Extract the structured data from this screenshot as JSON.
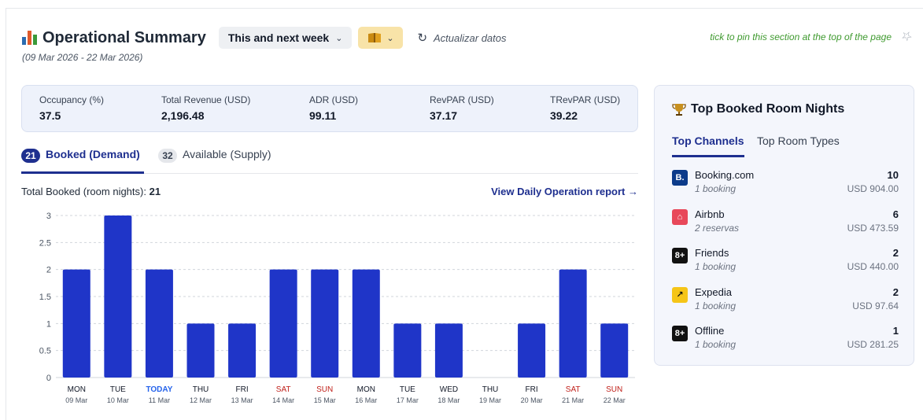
{
  "header": {
    "title": "Operational Summary",
    "range_label": "This and next week",
    "refresh_label": "Actualizar datos",
    "date_range": "(09 Mar 2026 - 22 Mar 2026)",
    "pin_note": "tick to pin this section at the top of the page"
  },
  "kpis": [
    {
      "label": "Occupancy (%)",
      "value": "37.5"
    },
    {
      "label": "Total Revenue (USD)",
      "value": "2,196.48"
    },
    {
      "label": "ADR (USD)",
      "value": "99.11"
    },
    {
      "label": "RevPAR (USD)",
      "value": "37.17"
    },
    {
      "label": "TRevPAR (USD)",
      "value": "39.22"
    }
  ],
  "tabs": [
    {
      "badge": "21",
      "label": "Booked (Demand)"
    },
    {
      "badge": "32",
      "label": "Available (Supply)"
    }
  ],
  "total_booked": {
    "label": "Total Booked (room nights):",
    "value": "21"
  },
  "view_report": "View Daily Operation report →",
  "chart_data": {
    "type": "bar",
    "categories": [
      "09 Mar",
      "10 Mar",
      "11 Mar",
      "12 Mar",
      "13 Mar",
      "14 Mar",
      "15 Mar",
      "16 Mar",
      "17 Mar",
      "18 Mar",
      "19 Mar",
      "20 Mar",
      "21 Mar",
      "22 Mar"
    ],
    "days": [
      "MON",
      "TUE",
      "TODAY",
      "THU",
      "FRI",
      "SAT",
      "SUN",
      "MON",
      "TUE",
      "WED",
      "THU",
      "FRI",
      "SAT",
      "SUN"
    ],
    "day_types": [
      "normal",
      "normal",
      "today",
      "normal",
      "normal",
      "weekend",
      "weekend",
      "normal",
      "normal",
      "normal",
      "normal",
      "normal",
      "weekend",
      "weekend"
    ],
    "values": [
      2,
      3,
      2,
      1,
      1,
      2,
      2,
      2,
      1,
      1,
      0,
      1,
      2,
      1
    ],
    "yticks": [
      "0",
      "0.5",
      "1",
      "1.5",
      "2",
      "2.5",
      "3"
    ],
    "ylim": [
      0,
      3
    ],
    "grid": true,
    "bar_color": "#1f35c8",
    "today_color": "#2563eb",
    "weekend_color": "#c0201a"
  },
  "panel": {
    "title": "Top Booked Room Nights",
    "tabs": [
      "Top Channels",
      "Top Room Types"
    ],
    "channels": [
      {
        "icon": "booking-icon",
        "logo_text": "B.",
        "logo_color": "#0c3b8a",
        "name": "Booking.com",
        "sub": "1 booking",
        "count": "10",
        "amount": "USD 904.00"
      },
      {
        "icon": "airbnb-icon",
        "logo_text": "⌂",
        "logo_color": "#e8485a",
        "name": "Airbnb",
        "sub": "2 reservas",
        "count": "6",
        "amount": "USD 473.59"
      },
      {
        "icon": "friends-icon",
        "logo_text": "8+",
        "logo_color": "#111111",
        "name": "Friends",
        "sub": "1 booking",
        "count": "2",
        "amount": "USD 440.00"
      },
      {
        "icon": "expedia-icon",
        "logo_text": "↗",
        "logo_color": "#f5c518",
        "name": "Expedia",
        "sub": "1 booking",
        "count": "2",
        "amount": "USD 97.64"
      },
      {
        "icon": "offline-icon",
        "logo_text": "8+",
        "logo_color": "#111111",
        "name": "Offline",
        "sub": "1 booking",
        "count": "1",
        "amount": "USD 281.25"
      }
    ]
  }
}
